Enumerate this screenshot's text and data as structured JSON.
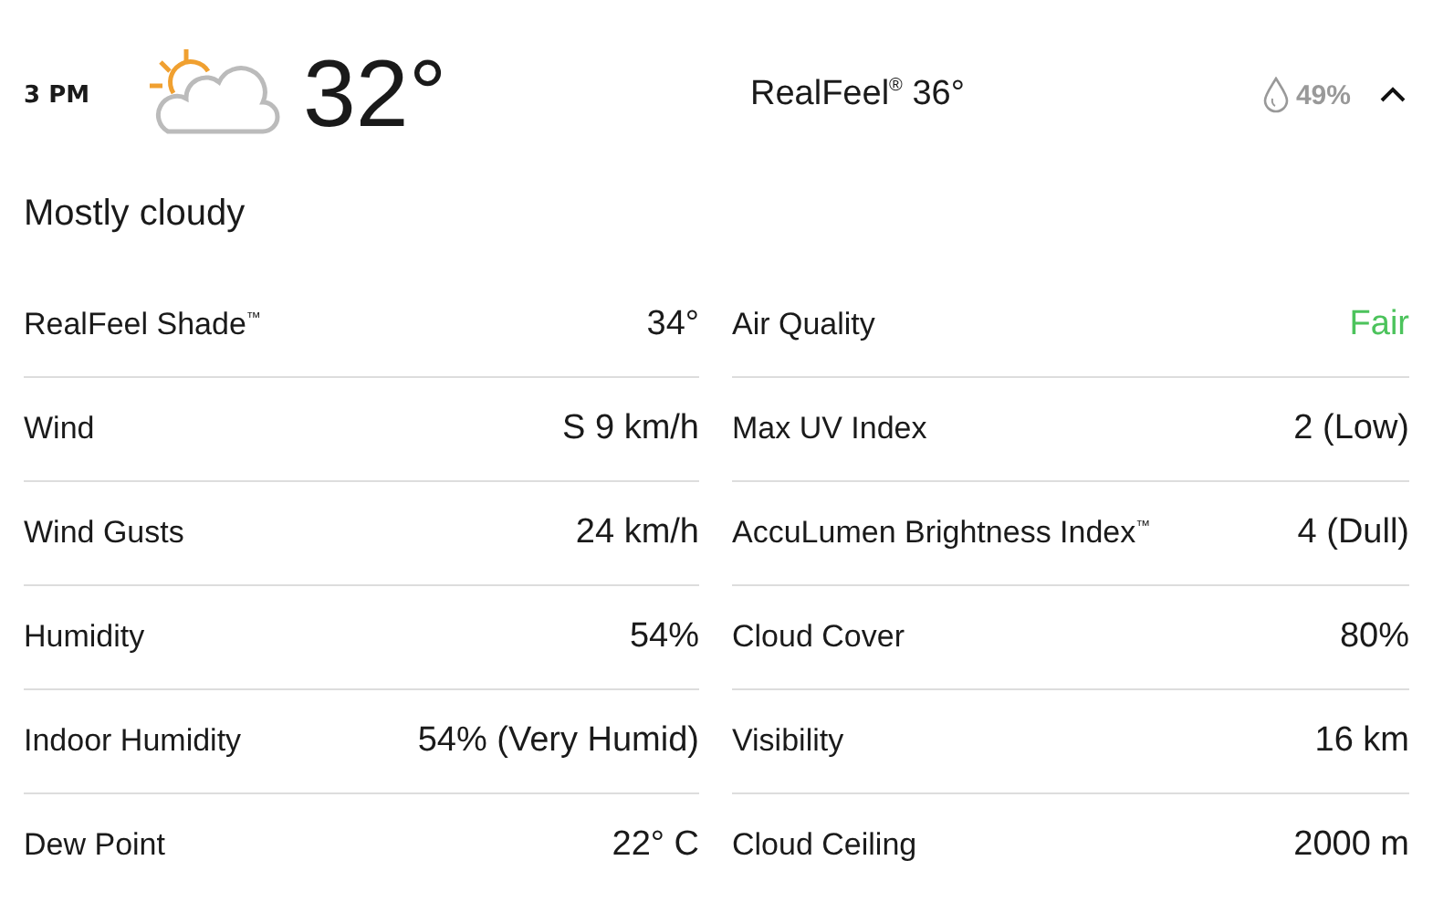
{
  "hour": {
    "time": "3 PM",
    "temperature": "32°",
    "realfeel": "RealFeel$^{®}$ 36°",
    "precipitation": "49%",
    "expanded": true
  },
  "phrase": "Mostly cloudy",
  "details_left": [
    {
      "label": "RealFeel Shade$^{™}$",
      "value": "34°"
    },
    {
      "label": "Wind",
      "value": "S 9 km/h"
    },
    {
      "label": "Wind Gusts",
      "value": "24 km/h"
    },
    {
      "label": "Humidity",
      "value": "54%"
    },
    {
      "label": "Indoor Humidity",
      "value": "54% (Very Humid)"
    },
    {
      "label": "Dew Point",
      "value": "22° C"
    }
  ],
  "details_right": [
    {
      "label": "Air Quality",
      "value": "Fair",
      "color": "#4cc35c"
    },
    {
      "label": "Max UV Index",
      "value": "2 (Low)"
    },
    {
      "label": "AccuLumen Brightness Index$^{™}$",
      "value": "4 (Dull)"
    },
    {
      "label": "Cloud Cover",
      "value": "80%"
    },
    {
      "label": "Visibility",
      "value": "16 km"
    },
    {
      "label": "Cloud Ceiling",
      "value": "2000 m"
    }
  ]
}
